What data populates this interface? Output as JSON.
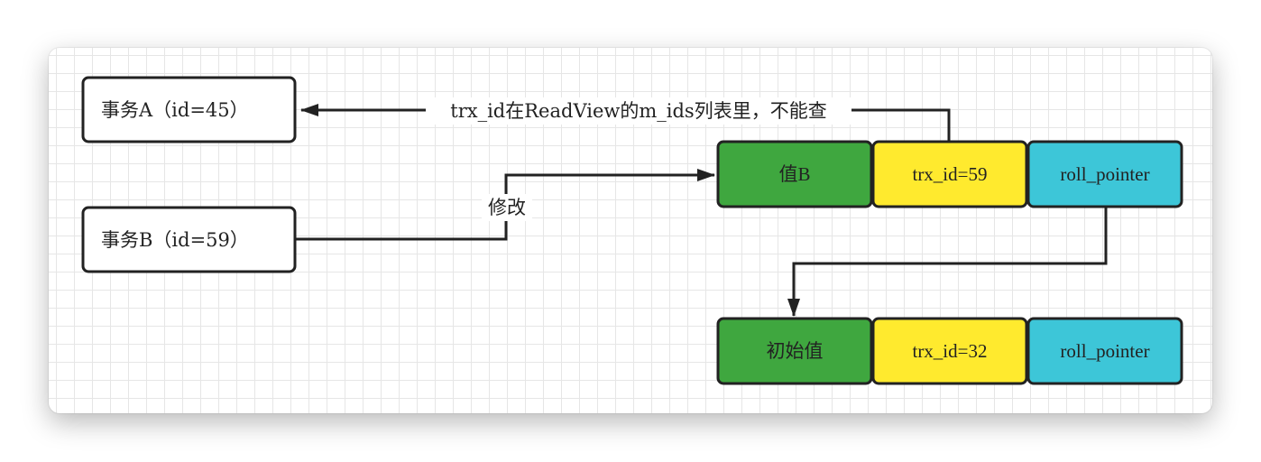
{
  "transactions": [
    {
      "label": "事务A（id=45）"
    },
    {
      "label": "事务B（id=59）"
    }
  ],
  "edges": {
    "visibility_label": "trx_id在ReadView的m_ids列表里，不能查",
    "modify_label": "修改"
  },
  "records": [
    {
      "value": "值B",
      "trx_id": "trx_id=59",
      "roll_pointer": "roll_pointer"
    },
    {
      "value": "初始值",
      "trx_id": "trx_id=32",
      "roll_pointer": "roll_pointer"
    }
  ],
  "colors": {
    "value_cell": "#3fa73f",
    "trx_cell": "#ffea2e",
    "pointer_cell": "#3dc6d8",
    "stroke": "#222222",
    "grid": "#e6e6e6"
  }
}
